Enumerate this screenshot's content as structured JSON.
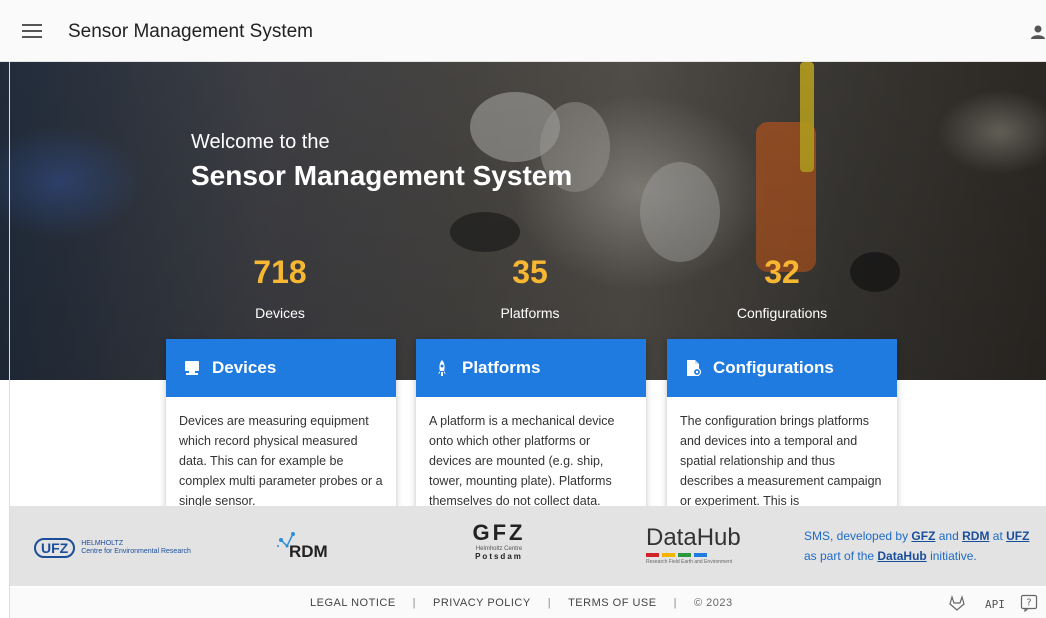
{
  "appbar": {
    "title": "Sensor Management System",
    "menu_icon": "menu-icon",
    "user_icon": "account-icon"
  },
  "hero": {
    "welcome": "Welcome to the",
    "headline": "Sensor Management System",
    "stats": [
      {
        "value": "718",
        "label": "Devices"
      },
      {
        "value": "35",
        "label": "Platforms"
      },
      {
        "value": "32",
        "label": "Configurations"
      }
    ]
  },
  "cards": [
    {
      "title": "Devices",
      "icon": "monitor-icon",
      "text": "Devices are measuring equipment which record physical measured data. This can for example be complex multi parameter probes or a single sensor."
    },
    {
      "title": "Platforms",
      "icon": "rocket-icon",
      "text": "A platform is a mechanical device onto which other platforms or devices are mounted (e.g. ship, tower, mounting plate). Platforms themselves do not collect data."
    },
    {
      "title": "Configurations",
      "icon": "file-cog-icon",
      "text": "The configuration brings platforms and devices into a temporal and spatial relationship and thus describes a measurement campaign or experiment. This is"
    }
  ],
  "logos": {
    "ufz": {
      "word": "UFZ",
      "line1": "HELMHOLTZ",
      "line2": "Centre for Environmental Research"
    },
    "rdm": {
      "word": "RDM"
    },
    "gfz": {
      "word": "GFZ",
      "sub": "Helmholtz Centre",
      "city": "Potsdam"
    },
    "datahub": {
      "word": "DataHub",
      "sub": "Research Field Earth and Environment"
    }
  },
  "credits": {
    "part1": "SMS, developed by ",
    "gfz": "GFZ",
    "part2": " and ",
    "rdm": "RDM",
    "part3": " at ",
    "ufz": "UFZ",
    "part4": "as part of the ",
    "datahub": "DataHub",
    "part5": " initiative."
  },
  "footer": {
    "legal": "LEGAL NOTICE",
    "privacy": "PRIVACY POLICY",
    "terms": "TERMS OF USE",
    "sep": "|",
    "copyright": "© 2023",
    "gitlab_icon": "gitlab-icon",
    "api": "API",
    "help_icon": "help-icon"
  },
  "colors": {
    "accent": "#1f7be0",
    "stat": "#f7b733",
    "link": "#1b4e9a"
  }
}
